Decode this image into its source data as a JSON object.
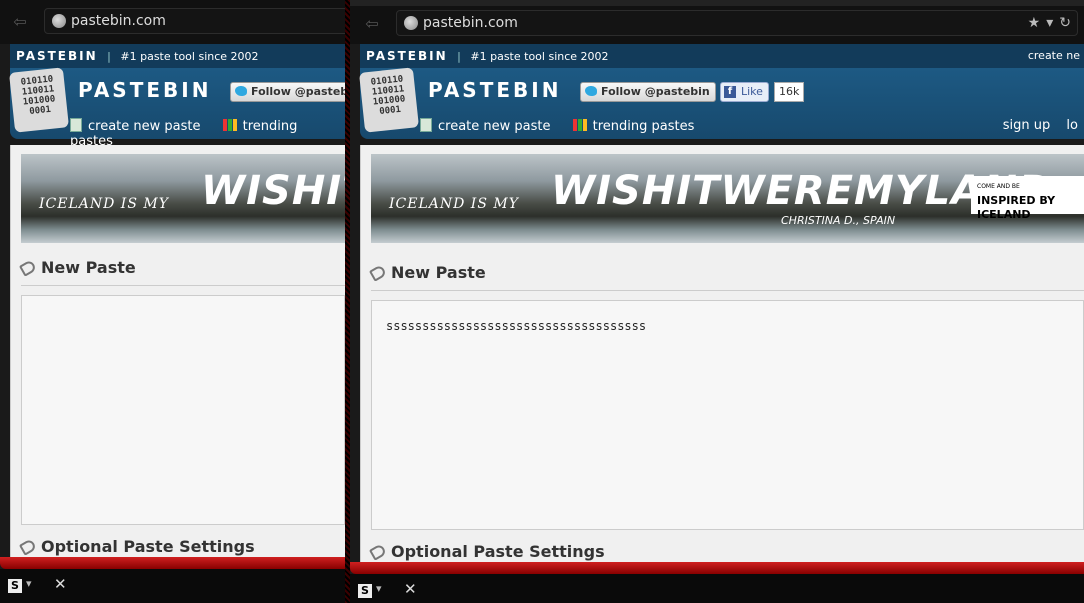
{
  "browser": {
    "url": "pastebin.com"
  },
  "site": {
    "brand": "PASTEBIN",
    "tagline": "#1 paste tool since 2002",
    "top_right_link": "create ne",
    "logo_bits": [
      "010110",
      "110011",
      "101000",
      "0001"
    ],
    "twitter_follow": "Follow @pastebin",
    "twitter_follow_truncated": "Follow @pastebi",
    "fb_like": "Like",
    "fb_count": "16k",
    "nav": {
      "create_new_paste": "create new paste",
      "trending_pastes": "trending pastes",
      "sign_up": "sign up",
      "login": "lo"
    }
  },
  "banner": {
    "iceland_is_my": "ICELAND IS MY",
    "headline": "WISHITWEREMYLAND",
    "headline_left": "WISHITW",
    "author": "CHRISTINA D., SPAIN",
    "inspired_small": "COME AND BE",
    "inspired_big": "INSPIRED BY ICELAND"
  },
  "paste": {
    "new_paste_title": "New Paste",
    "content_right": "ssssssssssssssssssssssssssssssssssss",
    "content_left": "",
    "settings_title": "Optional Paste Settings"
  },
  "statusbar": {
    "s_label": "S",
    "close": "✕"
  },
  "colors": {
    "header_blue": "#1f5f8b",
    "accent_red": "#d02020"
  }
}
